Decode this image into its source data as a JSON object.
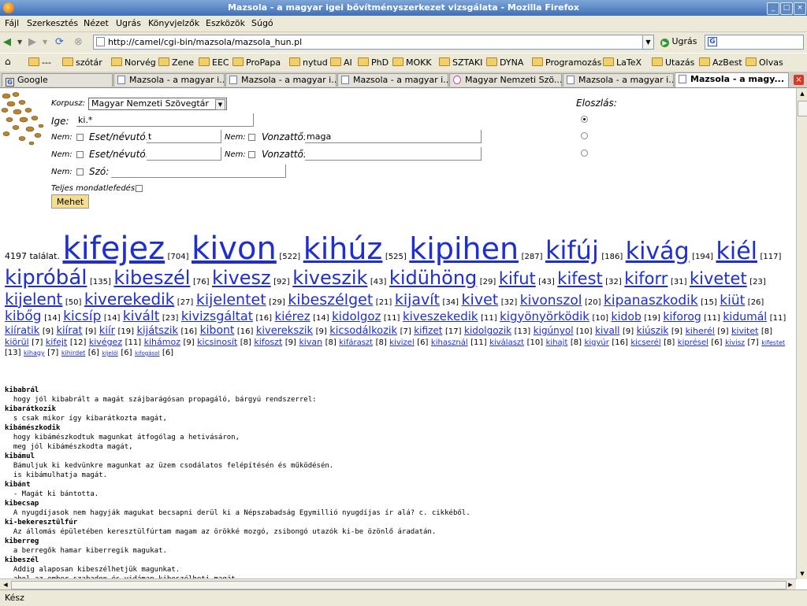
{
  "window": {
    "title": "Mazsola - a magyar igei bővítményszerkezet vizsgálata - Mozilla Firefox"
  },
  "menu": [
    "Fájl",
    "Szerkesztés",
    "Nézet",
    "Ugrás",
    "Könyvjelzők",
    "Eszközök",
    "Súgó"
  ],
  "nav": {
    "url": "http://camel/cgi-bin/mazsola/mazsola_hun.pl",
    "go_label": "Ugrás"
  },
  "bookmarks": [
    "---",
    "szótár",
    "Norvég",
    "Zene",
    "EEC",
    "ProPapa",
    "nytud",
    "AI",
    "PhD",
    "MOKK",
    "SZTAKI",
    "DYNA",
    "Programozás",
    "LaTeX",
    "Utazás",
    "AzBest",
    "Olvas"
  ],
  "tabs": [
    {
      "label": "Google"
    },
    {
      "label": "Mazsola - a magyar i..."
    },
    {
      "label": "Mazsola - a magyar i..."
    },
    {
      "label": "Mazsola - a magyar i..."
    },
    {
      "label": "Magyar Nemzeti Szö..."
    },
    {
      "label": "Mazsola - a magyar i..."
    },
    {
      "label": "Mazsola - a magy..."
    }
  ],
  "form": {
    "corpus_label": "Korpusz:",
    "corpus_value": "Magyar Nemzeti Szövegtár",
    "verb_label": "Ige:",
    "verb_value": "ki.*",
    "not_label": "Nem:",
    "case_label": "Eset/névutó:",
    "vonzatto_label": "Vonzattő:",
    "word_label": "Szó:",
    "row1_case": "t",
    "row1_vonzatto": "maga",
    "fullsentence_label": "Teljes mondatlefedés:",
    "submit_label": "Mehet",
    "distribution_label": "Eloszlás:"
  },
  "cloud": {
    "intro": "4197 találat.",
    "words": [
      {
        "w": "kifejez",
        "c": "704",
        "s": 40
      },
      {
        "w": "kivon",
        "c": "522",
        "s": 40
      },
      {
        "w": "kihúz",
        "c": "525",
        "s": 38
      },
      {
        "w": "kipihen",
        "c": "287",
        "s": 38
      },
      {
        "w": "kifúj",
        "c": "186",
        "s": 32
      },
      {
        "w": "kivág",
        "c": "194",
        "s": 30
      },
      {
        "w": "kiél",
        "c": "117",
        "s": 30
      },
      {
        "w": "kipróbál",
        "c": "135",
        "s": 26
      },
      {
        "w": "kibeszél",
        "c": "76",
        "s": 24
      },
      {
        "w": "kivesz",
        "c": "92",
        "s": 24
      },
      {
        "w": "kiveszik",
        "c": "43",
        "s": 24
      },
      {
        "w": "kidühöng",
        "c": "29",
        "s": 24
      },
      {
        "w": "kifut",
        "c": "43",
        "s": 21
      },
      {
        "w": "kifest",
        "c": "32",
        "s": 21
      },
      {
        "w": "kiforr",
        "c": "31",
        "s": 21
      },
      {
        "w": "kivetet",
        "c": "23",
        "s": 21
      },
      {
        "w": "kijelent",
        "c": "50",
        "s": 20
      },
      {
        "w": "kiverekedik",
        "c": "27",
        "s": 20
      },
      {
        "w": "kijelentet",
        "c": "29",
        "s": 19
      },
      {
        "w": "kibeszélget",
        "c": "21",
        "s": 19
      },
      {
        "w": "kijavít",
        "c": "34",
        "s": 19
      },
      {
        "w": "kivet",
        "c": "32",
        "s": 19
      },
      {
        "w": "kivonszol",
        "c": "20",
        "s": 17
      },
      {
        "w": "kipanaszkodik",
        "c": "15",
        "s": 17
      },
      {
        "w": "kiüt",
        "c": "26",
        "s": 17
      },
      {
        "w": "kibőg",
        "c": "14",
        "s": 17
      },
      {
        "w": "kicsíp",
        "c": "14",
        "s": 17
      },
      {
        "w": "kivált",
        "c": "23",
        "s": 17
      },
      {
        "w": "kivizsgáltat",
        "c": "16",
        "s": 16
      },
      {
        "w": "kiérez",
        "c": "14",
        "s": 15
      },
      {
        "w": "kidolgoz",
        "c": "11",
        "s": 15
      },
      {
        "w": "kiveszekedik",
        "c": "11",
        "s": 15
      },
      {
        "w": "kigyönyörködik",
        "c": "10",
        "s": 15
      },
      {
        "w": "kidob",
        "c": "19",
        "s": 14
      },
      {
        "w": "kiforog",
        "c": "11",
        "s": 14
      },
      {
        "w": "kidumál",
        "c": "11",
        "s": 14
      },
      {
        "w": "kiíratik",
        "c": "9",
        "s": 13
      },
      {
        "w": "kiírat",
        "c": "9",
        "s": 13
      },
      {
        "w": "kiír",
        "c": "19",
        "s": 13
      },
      {
        "w": "kijátszik",
        "c": "16",
        "s": 13
      },
      {
        "w": "kibont",
        "c": "16",
        "s": 14
      },
      {
        "w": "kiverekszik",
        "c": "9",
        "s": 13
      },
      {
        "w": "kicsodálkozik",
        "c": "7",
        "s": 13
      },
      {
        "w": "kifizet",
        "c": "17",
        "s": 12
      },
      {
        "w": "kidolgozik",
        "c": "13",
        "s": 12
      },
      {
        "w": "kigúnyol",
        "c": "10",
        "s": 12
      },
      {
        "w": "kivall",
        "c": "9",
        "s": 12
      },
      {
        "w": "kiúszik",
        "c": "9",
        "s": 12
      },
      {
        "w": "kiherél",
        "c": "9",
        "s": 11
      },
      {
        "w": "kivitet",
        "c": "8",
        "s": 11
      },
      {
        "w": "kiörül",
        "c": "7",
        "s": 11
      },
      {
        "w": "kifejt",
        "c": "12",
        "s": 11
      },
      {
        "w": "kivégez",
        "c": "11",
        "s": 11
      },
      {
        "w": "kihámoz",
        "c": "9",
        "s": 11
      },
      {
        "w": "kicsinosít",
        "c": "8",
        "s": 11
      },
      {
        "w": "kifoszt",
        "c": "9",
        "s": 11
      },
      {
        "w": "kivan",
        "c": "8",
        "s": 11
      },
      {
        "w": "kifáraszt",
        "c": "8",
        "s": 10
      },
      {
        "w": "kivizel",
        "c": "6",
        "s": 10
      },
      {
        "w": "kihasznál",
        "c": "11",
        "s": 10
      },
      {
        "w": "kiválaszt",
        "c": "10",
        "s": 10
      },
      {
        "w": "kihajt",
        "c": "8",
        "s": 10
      },
      {
        "w": "kigyúr",
        "c": "16",
        "s": 10
      },
      {
        "w": "kicserél",
        "c": "8",
        "s": 10
      },
      {
        "w": "kiprésel",
        "c": "6",
        "s": 10
      },
      {
        "w": "kivisz",
        "c": "7",
        "s": 9
      },
      {
        "w": "kifestet",
        "c": "13",
        "s": 8
      },
      {
        "w": "kihagy",
        "c": "7",
        "s": 8
      },
      {
        "w": "kihirdet",
        "c": "6",
        "s": 8
      },
      {
        "w": "kijelöl",
        "c": "6",
        "s": 7
      },
      {
        "w": "kifogásol",
        "c": "6",
        "s": 7
      }
    ]
  },
  "results": [
    {
      "verb": "kibabrál",
      "lines": [
        "  hogy jól kibabrált a magát szájbarágósan propagáló, bárgyú rendszerrel:"
      ]
    },
    {
      "verb": "kibarátkozik",
      "lines": [
        "  s csak mikor így kibarátkozta magát,"
      ]
    },
    {
      "verb": "kibámészkodik",
      "lines": [
        "  hogy kibámészkodtuk magunkat átfogólag a hetivásáron,",
        "  meg jól kibámészkodta magát,"
      ]
    },
    {
      "verb": "kibámul",
      "lines": [
        "  Bámuljuk ki kedvünkre magunkat az üzem csodálatos felépítésén és működésén.",
        "  is kibámulhatja magát."
      ]
    },
    {
      "verb": "kibánt",
      "lines": [
        "  - Magát ki bántotta."
      ]
    },
    {
      "verb": "kibecsap",
      "lines": [
        "  A nyugdíjasok nem hagyják magukat becsapni derül ki a Népszabadság Egymillió nyugdíjas ír alá? c. cikkéből."
      ]
    },
    {
      "verb": "ki-bekeresztülfúr",
      "lines": [
        "  Az állomás épületében keresztülfúrtam magam az örökké mozgó, zsibongó utazók ki-be özönlő áradatán."
      ]
    },
    {
      "verb": "kiberreg",
      "lines": [
        "  a berregők hamar kiberregik magukat."
      ]
    },
    {
      "verb": "kibeszél",
      "lines": [
        "  Addig alaposan kibeszélhetjük magunkat.",
        "  ahol az ember szabadon és vidáman kibeszélheti magát"
      ]
    }
  ],
  "status": "Kész"
}
